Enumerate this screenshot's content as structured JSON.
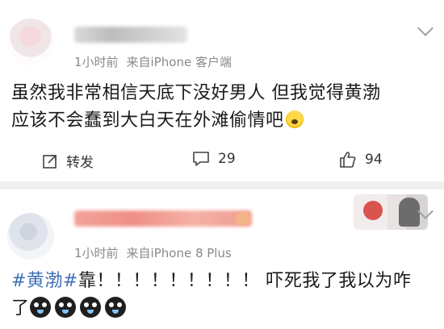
{
  "posts": [
    {
      "meta": {
        "time": "1小时前",
        "source": "来自iPhone 客户端"
      },
      "content": {
        "line1": "虽然我非常相信天底下没好男人 但我觉得黄渤",
        "line2": "应该不会蠢到大白天在外滩偷情吧"
      },
      "actions": {
        "repost_label": "转发",
        "comment_count": "29",
        "like_count": "94"
      }
    },
    {
      "meta": {
        "time": "1小时前",
        "source": "来自iPhone 8 Plus"
      },
      "content": {
        "hashtag": "#黄渤#",
        "line1_rest": "靠！！！！！！！！！ 吓死我了我以为咋",
        "line2": "了"
      }
    }
  ],
  "icons": [
    "chevron-down-icon",
    "repost-icon",
    "comment-icon",
    "like-icon",
    "scared-emoji-icon",
    "crying-emoji-icon"
  ]
}
